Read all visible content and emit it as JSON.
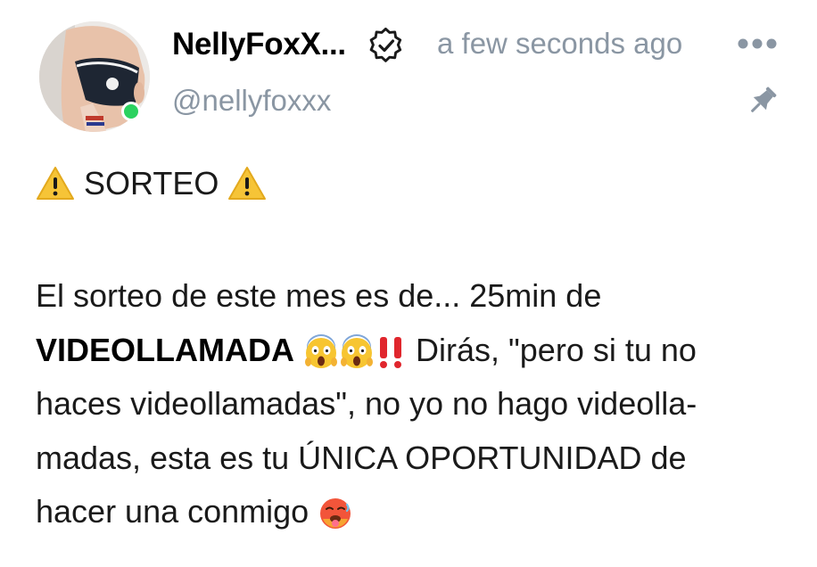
{
  "author": {
    "display_name": "NellyFoxX...",
    "username": "@nellyfoxxx",
    "online": true,
    "verified": true
  },
  "post": {
    "timestamp": "a few seconds ago",
    "pinned": true,
    "heading": "SORTEO",
    "line1": "El sorteo de este mes es de... 25min de",
    "line2_bold": "VIDEOLLAMADA",
    "line2_rest": "Dirás, \"pero si tu no",
    "line3": "haces videollamadas\", no yo no hago videolla-",
    "line4": "madas, esta es tu ÚNICA OPORTUNIDAD de",
    "line5": "hacer una conmigo"
  },
  "icons": {
    "verified": "verified-badge-icon",
    "more": "more-options-icon",
    "pin": "pin-icon",
    "warning": "warning-emoji",
    "scream": "face-screaming-emoji",
    "exclamation": "double-exclamation-emoji",
    "hot_face": "hot-face-emoji"
  },
  "colors": {
    "muted": "#8a96a3",
    "online": "#2bd25f",
    "accent_red": "#e0262d",
    "warning_yellow": "#f6c437"
  }
}
